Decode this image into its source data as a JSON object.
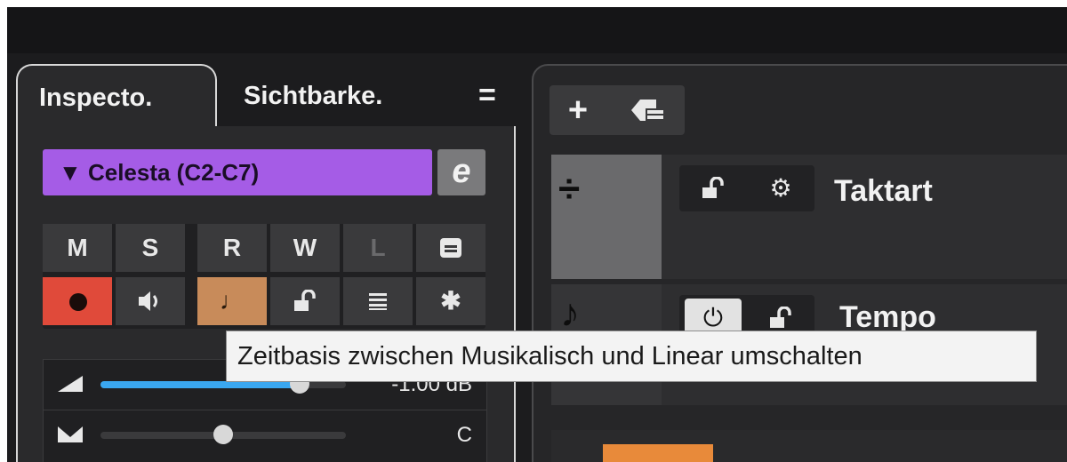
{
  "inspector": {
    "tabs": [
      {
        "label": "Inspecto."
      },
      {
        "label": "Sichtbarke."
      }
    ],
    "menu_icon": "hamburger-menu-icon",
    "track_name": "▼ Celesta (C2-C7)",
    "edit_label": "e",
    "buttons_row1": [
      "M",
      "S",
      "R",
      "W",
      "L"
    ],
    "buttons_row2_icons": [
      "record-enable-icon",
      "monitor-speaker-icon",
      "timebase-note-icon",
      "lock-icon",
      "lanes-icon",
      "freeze-asterisk-icon"
    ],
    "note_glyph": "♩",
    "asterisk_glyph": "✱",
    "fader_volume_value": "-1.00 dB",
    "fader_volume_level": 0.81,
    "fader_pan_value": "C",
    "fader_pan_level": 0.5
  },
  "project": {
    "add_track_glyph": "+",
    "tracks": [
      {
        "title": "Taktart",
        "icon_glyph": "÷"
      },
      {
        "title": "Tempo",
        "icon_glyph": "♪"
      }
    ]
  },
  "tooltip": {
    "text": "Zeitbasis zwischen Musikalisch und Linear umschalten"
  },
  "colors": {
    "track_color": "#a55ce6",
    "record_red": "#e04a3a",
    "timebase_tan": "#c88b5a",
    "fader_blue": "#3aa7f0",
    "clip_orange": "#e88a3a"
  }
}
